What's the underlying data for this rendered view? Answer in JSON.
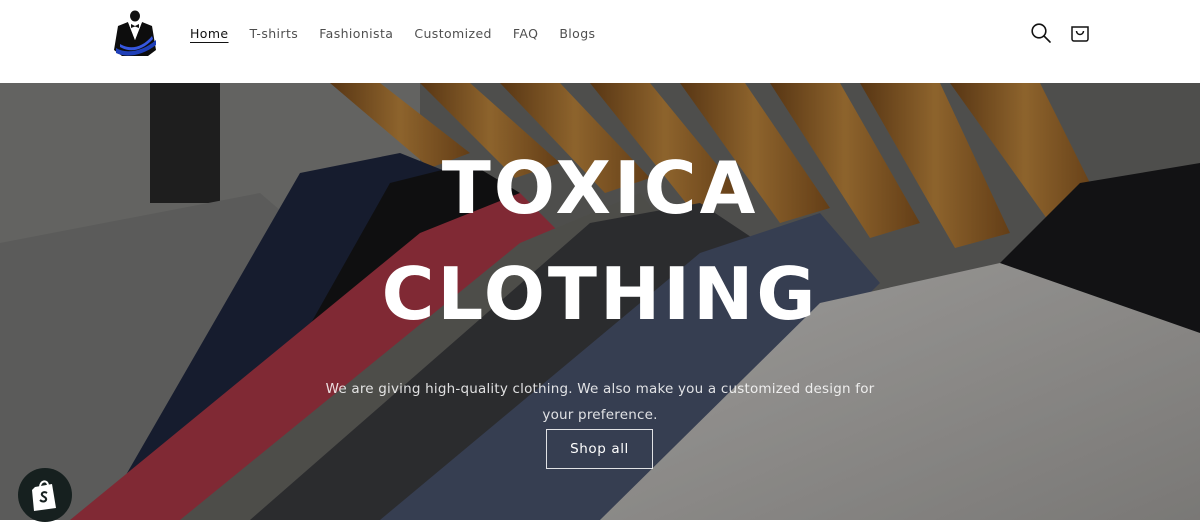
{
  "brand": {
    "logo_icon": "tuxedo-logo-icon"
  },
  "nav": {
    "items": [
      {
        "label": "Home",
        "active": true
      },
      {
        "label": "T-shirts",
        "active": false
      },
      {
        "label": "Fashionista",
        "active": false
      },
      {
        "label": "Customized",
        "active": false
      },
      {
        "label": "FAQ",
        "active": false
      },
      {
        "label": "Blogs",
        "active": false
      }
    ]
  },
  "header_icons": {
    "search": "search-icon",
    "cart": "cart-icon"
  },
  "hero": {
    "title_line1": "TOXICA",
    "title_line2": "CLOTHING",
    "description": "We are giving high-quality clothing. We also make you a customized design for your preference.",
    "cta_label": "Shop all",
    "background": "clothing-on-hangers-image"
  },
  "badge": {
    "icon": "shopify-bag-icon"
  },
  "colors": {
    "text": "#121212",
    "header_bg": "#ffffff",
    "badge_bg": "#16201f"
  }
}
